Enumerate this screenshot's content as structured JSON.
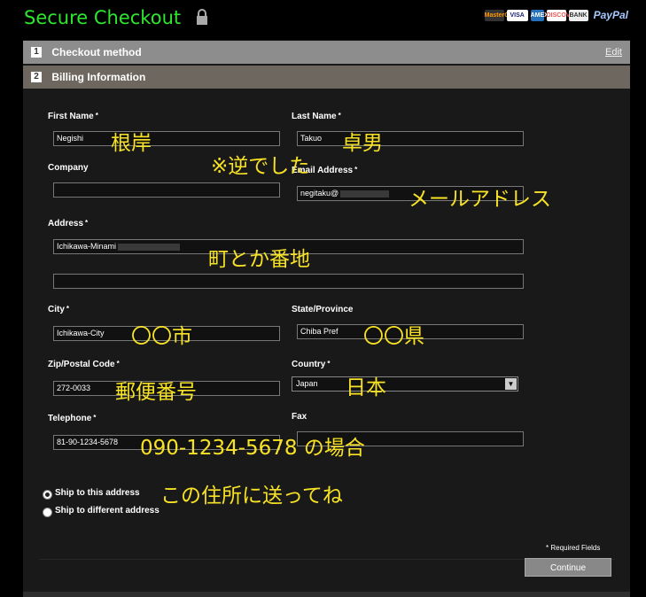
{
  "header": {
    "title": "Secure Checkout",
    "payment_marks": [
      "MasterCard",
      "VISA",
      "AMEX",
      "DISCOVER",
      "BANK",
      "PayPal"
    ]
  },
  "steps": [
    {
      "num": "1",
      "label": "Checkout method",
      "edit": "Edit"
    },
    {
      "num": "2",
      "label": "Billing Information"
    }
  ],
  "form": {
    "first_name": {
      "label": "First Name",
      "value": "Negishi"
    },
    "last_name": {
      "label": "Last Name",
      "value": "Takuo"
    },
    "company": {
      "label": "Company",
      "value": ""
    },
    "email": {
      "label": "Email Address",
      "value": "negitaku@"
    },
    "address": {
      "label": "Address",
      "value": "Ichikawa-Minami",
      "value2": ""
    },
    "city": {
      "label": "City",
      "value": "Ichikawa-City"
    },
    "state": {
      "label": "State/Province",
      "value": "Chiba Pref"
    },
    "zip": {
      "label": "Zip/Postal Code",
      "value": "272-0033"
    },
    "country": {
      "label": "Country",
      "value": "Japan"
    },
    "telephone": {
      "label": "Telephone",
      "value": "81-90-1234-5678"
    },
    "fax": {
      "label": "Fax",
      "value": ""
    },
    "required_mark": "*"
  },
  "shipping": {
    "option1": "Ship to this address",
    "option2": "Ship to different address",
    "selected": "option1"
  },
  "footer": {
    "required_note": "* Required Fields",
    "continue_label": "Continue"
  },
  "annotations": {
    "first_name": "根岸",
    "reversed": "※逆でした",
    "last_name": "卓男",
    "email": "メールアドレス",
    "address": "町とか番地",
    "city": "〇〇市",
    "state": "〇〇県",
    "zip": "郵便番号",
    "country": "日本",
    "telephone": "090-1234-5678 の場合",
    "ship": "この住所に送ってね"
  },
  "colors": {
    "title": "#2ee62e",
    "annotation": "#f7e225",
    "step1_bg": "#8d8d8d",
    "step2_bg": "#6e675f",
    "panel_bg": "#191919"
  }
}
